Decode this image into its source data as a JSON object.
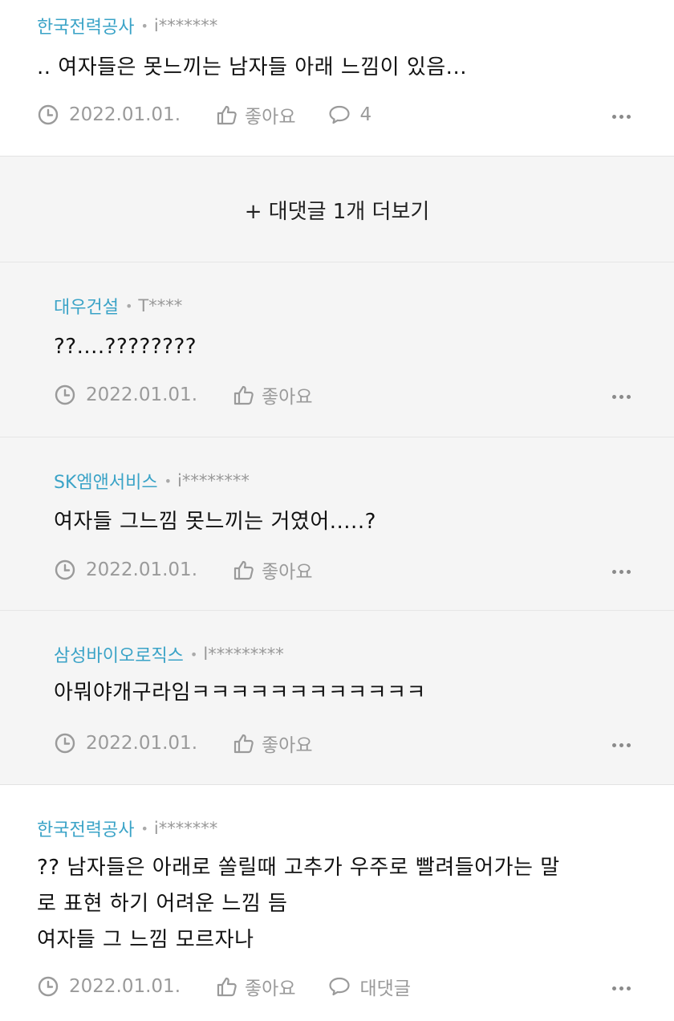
{
  "comments": [
    {
      "company": "한국전력공사",
      "author": "i*******",
      "lines": [
        ".. 여자들은 못느끼는 남자들 아래 느낌이 있음..."
      ],
      "date": "2022.01.01.",
      "like_label": "좋아요",
      "reply_label": "4"
    },
    {
      "company": "대우건설",
      "author": "T****",
      "lines": [
        "??....????????"
      ],
      "date": "2022.01.01.",
      "like_label": "좋아요"
    },
    {
      "company": "SK엠앤서비스",
      "author": "i********",
      "lines": [
        "여자들 그느낌 못느끼는 거였어.....?"
      ],
      "date": "2022.01.01.",
      "like_label": "좋아요"
    },
    {
      "company": "삼성바이오로직스",
      "author": "l*********",
      "lines": [
        "아뭐야개구라임ㅋㅋㅋㅋㅋㅋㅋㅋㅋㅋㅋㅋ"
      ],
      "date": "2022.01.01.",
      "like_label": "좋아요"
    },
    {
      "company": "한국전력공사",
      "author": "i*******",
      "lines": [
        "?? 남자들은 아래로 쏠릴때 고추가 우주로 빨려들어가는 말",
        "로 표현 하기 어려운 느낌 듬",
        "여자들 그 느낌 모르자나"
      ],
      "date": "2022.01.01.",
      "like_label": "좋아요",
      "reply_label": "대댓글"
    }
  ],
  "load_more_label": "+ 대댓글 1개 더보기",
  "icons": {
    "date": "clock-icon",
    "like": "thumbs-up-icon",
    "reply": "speech-bubble-icon",
    "more": "more-dots-icon"
  },
  "colors": {
    "company": "#3aa3c7",
    "reply_background": "#f5f5f5"
  }
}
